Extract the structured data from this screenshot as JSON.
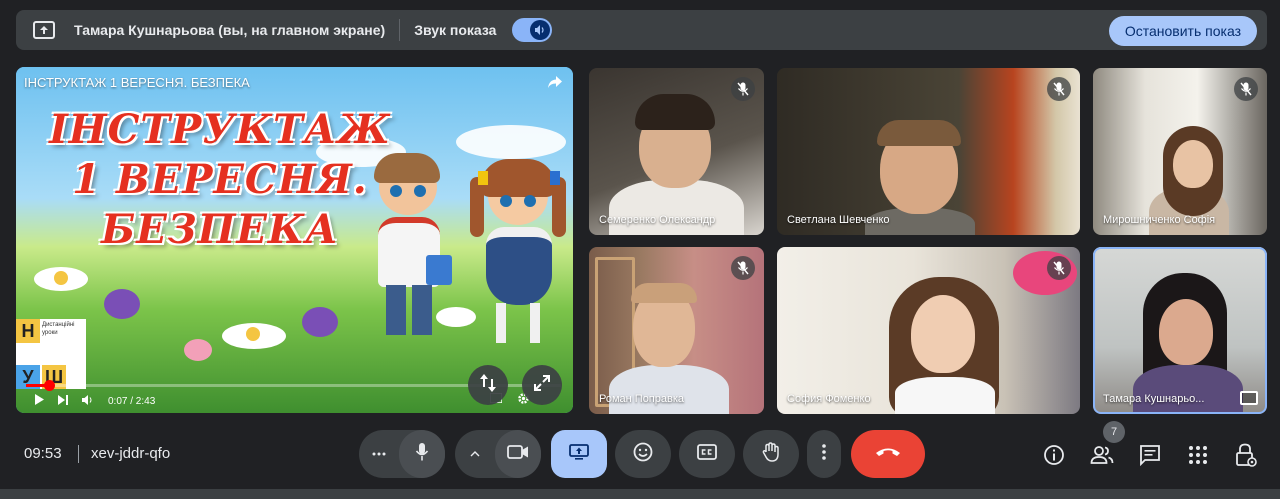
{
  "banner": {
    "presenter_text": "Тамара Кушнарьова (вы, на главном экране)",
    "sound_label": "Звук показа",
    "sound_on": true,
    "stop_button": "Остановить показ"
  },
  "presentation": {
    "title": "ІНСТРУКТАЖ 1 ВЕРЕСНЯ. БЕЗПЕКА",
    "slide_line1": "ІНСТРУКТАЖ",
    "slide_line2": "1 ВЕРЕСНЯ.",
    "slide_line3": "БЕЗПЕКА",
    "logo_letters": [
      "Н",
      "У",
      "Ш"
    ],
    "logo_caption": "Дистанційні уроки",
    "time_display": "0:07 / 2:43",
    "progress": 0.043
  },
  "participants": [
    {
      "name": "Семеренко Олександр",
      "muted": true
    },
    {
      "name": "Светлана Шевченко",
      "muted": true
    },
    {
      "name": "Мирошниченко Софія",
      "muted": true
    },
    {
      "name": "Роман Поправка",
      "muted": true
    },
    {
      "name": "София Фоменко",
      "muted": true
    },
    {
      "name": "Тамара Кушнарьо...",
      "muted": false,
      "active": true
    }
  ],
  "bottom": {
    "time": "09:53",
    "meeting_code": "xev-jddr-qfo",
    "participant_count": "7"
  },
  "icons": {
    "mic": "mic-icon",
    "camera": "camera-icon",
    "present": "present-screen-icon",
    "emoji": "emoji-icon",
    "captions": "captions-icon",
    "hand": "raise-hand-icon",
    "more": "more-vert-icon",
    "end_call": "end-call-icon",
    "info": "info-icon",
    "people": "people-icon",
    "chat": "chat-icon",
    "activities": "apps-grid-icon",
    "host": "host-controls-icon"
  },
  "colors": {
    "background": "#202124",
    "surface": "#3c4043",
    "accent": "#a8c7fa",
    "end_call": "#ea4335"
  }
}
